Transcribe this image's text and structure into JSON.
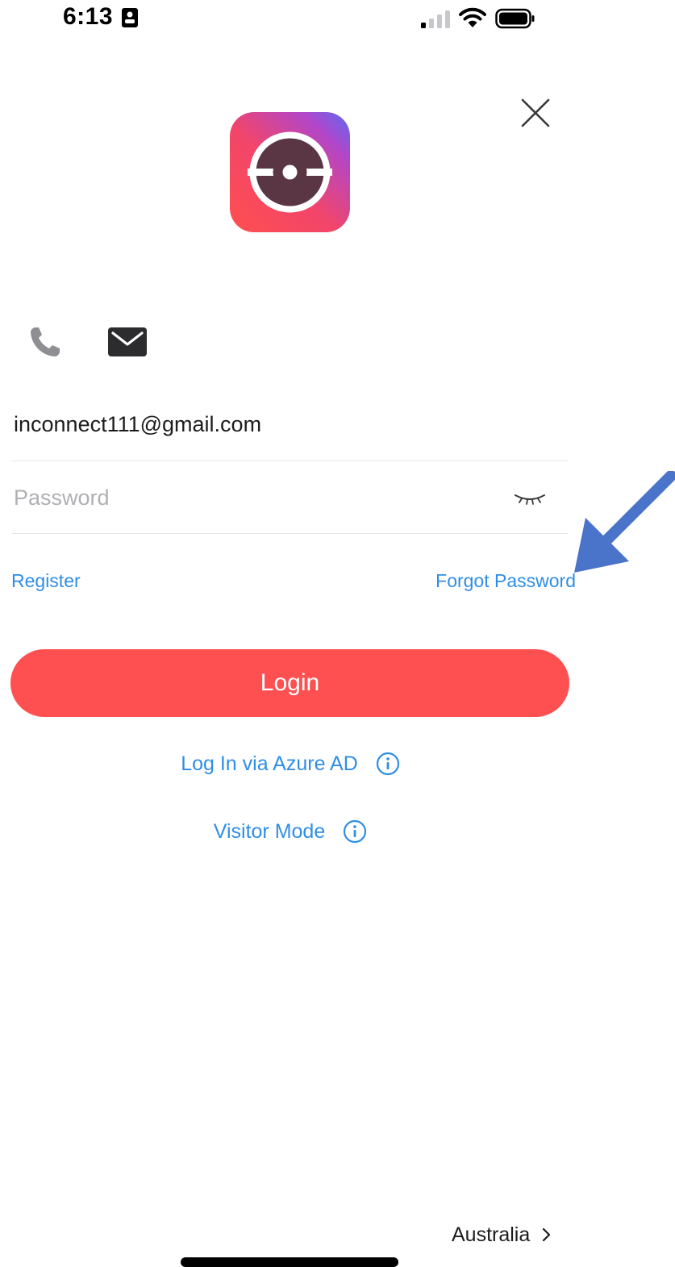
{
  "status_bar": {
    "time": "6:13"
  },
  "form": {
    "email_value": "inconnect111@gmail.com",
    "password_placeholder": "Password"
  },
  "links": {
    "register": "Register",
    "forgot_password": "Forgot Password"
  },
  "login_button": "Login",
  "alt_logins": {
    "azure": "Log In via Azure AD",
    "visitor": "Visitor Mode"
  },
  "region": {
    "label": "Australia"
  },
  "colors": {
    "accent": "#fe5050",
    "link": "#2f8ee6",
    "annotation_arrow": "#4a74c9"
  },
  "icons": {
    "close": "close-icon",
    "phone": "phone-icon",
    "email": "envelope-icon",
    "password_toggle": "eye-closed-icon",
    "info": "info-icon",
    "chevron": "chevron-right-icon"
  }
}
